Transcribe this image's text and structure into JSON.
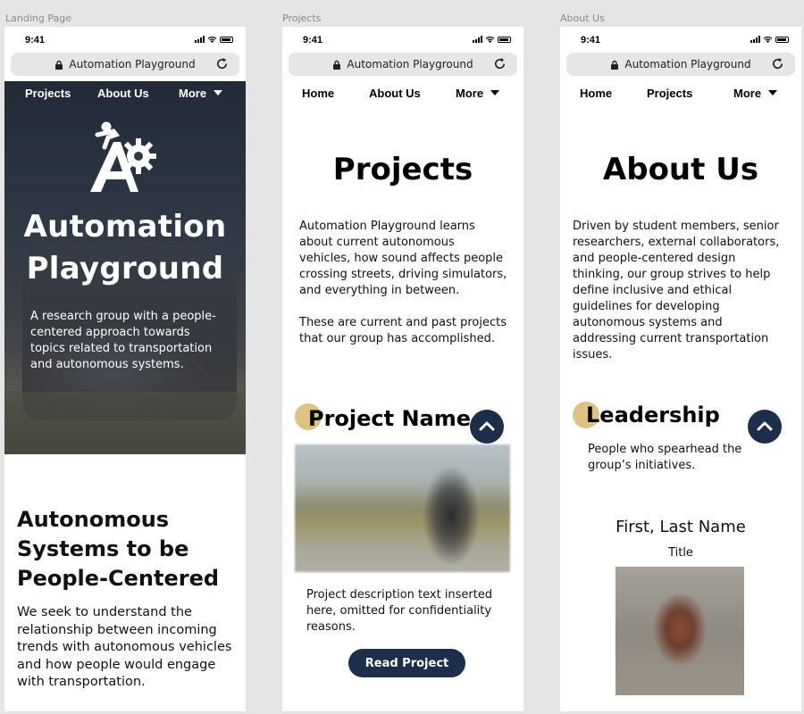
{
  "frames": [
    {
      "label": "Landing Page",
      "status_time": "9:41",
      "url": "Automation Playground",
      "nav": [
        "Projects",
        "About Us",
        "More"
      ],
      "hero": {
        "title_line1": "Automation",
        "title_line2": "Playground",
        "description": "A research group with a people-centered approach towards topics related to transportation and autonomous systems."
      },
      "section": {
        "heading": "Autonomous Systems to be People-Centered",
        "body": "We seek to understand the relationship between incoming trends with autonomous vehicles and how people would engage with transportation."
      }
    },
    {
      "label": "Projects",
      "status_time": "9:41",
      "url": "Automation Playground",
      "nav": [
        "Home",
        "About Us",
        "More"
      ],
      "title": "Projects",
      "intro_1": "Automation Playground learns about current autonomous vehicles, how sound affects people crossing streets, driving simulators, and everything in between.",
      "intro_2": "These are current and past projects that our group has accomplished.",
      "project_name": "Project Name",
      "project_description": "Project description text inserted here, omitted for confidentiality reasons.",
      "read_button": "Read Project"
    },
    {
      "label": "About Us",
      "status_time": "9:41",
      "url": "Automation Playground",
      "nav": [
        "Home",
        "Projects",
        "More"
      ],
      "title": "About Us",
      "intro": "Driven by student members, senior researchers, external collaborators, and people-centered design thinking, our group strives to help define inclusive and ethical guidelines for developing autonomous systems and addressing current transportation issues.",
      "section_title": "Leadership",
      "section_desc": "People who spearhead the group’s initiatives.",
      "person_name": "First, Last Name",
      "person_title": "Title"
    }
  ],
  "colors": {
    "accent_dot": "#dcc383",
    "navy": "#1c2e4a",
    "canvas": "#e5e5e5"
  },
  "icons": [
    "lock-icon",
    "reload-icon",
    "signal-icon",
    "wifi-icon",
    "battery-icon",
    "caret-down-icon",
    "chevron-up-icon",
    "automation-playground-logo"
  ]
}
